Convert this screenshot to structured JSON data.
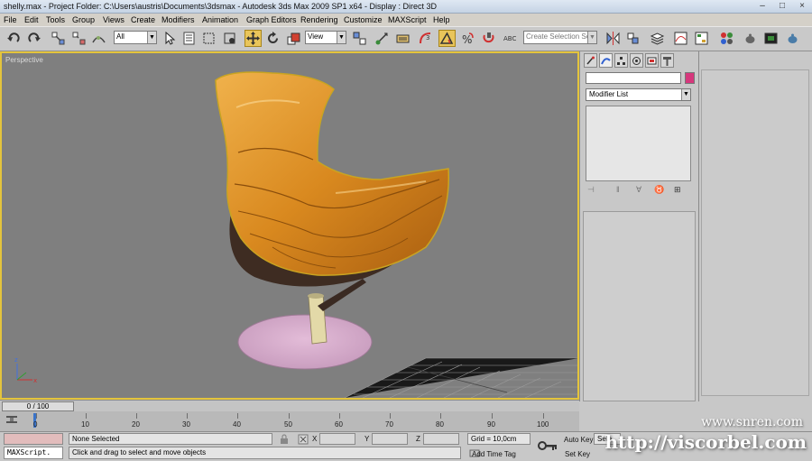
{
  "window": {
    "title": "shelly.max    - Project Folder: C:\\Users\\austris\\Documents\\3dsmax    - Autodesk 3ds Max  2009 SP1  x64    - Display : Direct 3D"
  },
  "menu": [
    "File",
    "Edit",
    "Tools",
    "Group",
    "Views",
    "Create",
    "Modifiers",
    "Animation",
    "Graph Editors",
    "Rendering",
    "Customize",
    "MAXScript",
    "Help"
  ],
  "toolbar": {
    "selection_filter": "All",
    "ref_coord": "View",
    "named_selection_placeholder": "Create Selection Set"
  },
  "viewport": {
    "label": "Perspective"
  },
  "command_panel": {
    "modifier_list": "Modifier List",
    "object_color": "#d6377c"
  },
  "timeline": {
    "frame_label": "0 / 100",
    "ticks": [
      "0",
      "10",
      "20",
      "30",
      "40",
      "50",
      "60",
      "70",
      "80",
      "90",
      "100"
    ]
  },
  "status": {
    "maxscript": "MAXScript.",
    "selection": "None Selected",
    "prompt": "Click and drag to select and move objects",
    "x_label": "X",
    "y_label": "Y",
    "z_label": "Z",
    "grid": "Grid = 10,0cm",
    "add_time_tag": "Add Time Tag",
    "auto_key": "Auto Key",
    "set_key": "Set Key",
    "selected": "Sele"
  },
  "watermarks": {
    "top": "www.snren.com",
    "bottom": "http://viscorbel.com"
  }
}
